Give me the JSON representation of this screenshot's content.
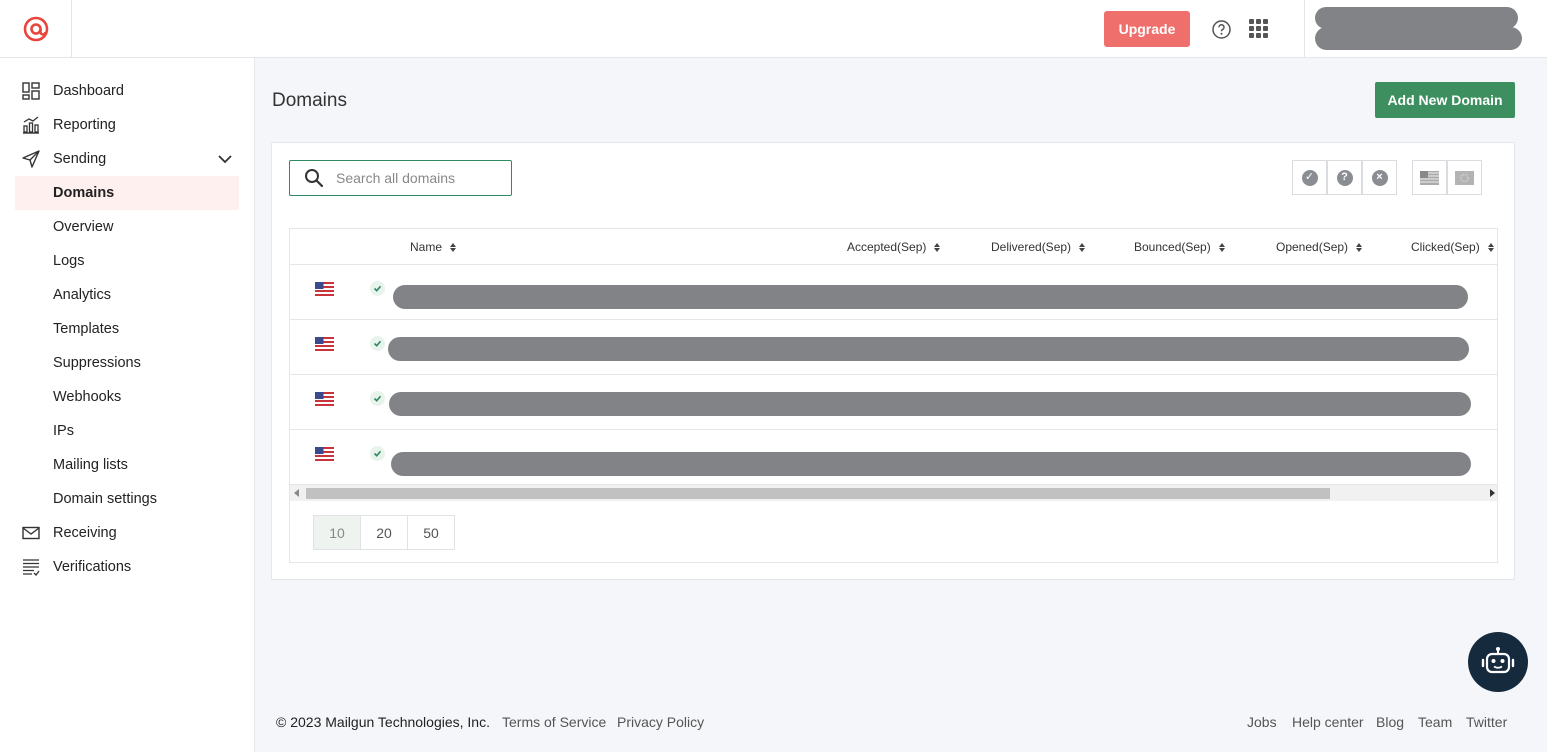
{
  "header": {
    "upgrade_label": "Upgrade"
  },
  "sidebar": {
    "items": [
      {
        "label": "Dashboard",
        "icon": "dashboard-icon"
      },
      {
        "label": "Reporting",
        "icon": "reporting-icon"
      },
      {
        "label": "Sending",
        "icon": "paper-plane-icon"
      },
      {
        "label": "Domains"
      },
      {
        "label": "Overview"
      },
      {
        "label": "Logs"
      },
      {
        "label": "Analytics"
      },
      {
        "label": "Templates"
      },
      {
        "label": "Suppressions"
      },
      {
        "label": "Webhooks"
      },
      {
        "label": "IPs"
      },
      {
        "label": "Mailing lists"
      },
      {
        "label": "Domain settings"
      },
      {
        "label": "Receiving",
        "icon": "envelope-icon"
      },
      {
        "label": "Verifications",
        "icon": "list-icon"
      }
    ]
  },
  "main": {
    "title": "Domains",
    "add_button_label": "Add New Domain",
    "search_placeholder": "Search all domains",
    "filters": {
      "verified": "✓",
      "unverified": "?",
      "disabled": "×"
    },
    "columns": [
      "Name",
      "Accepted(Sep)",
      "Delivered(Sep)",
      "Bounced(Sep)",
      "Opened(Sep)",
      "Clicked(Sep)"
    ],
    "rows": [
      {
        "flag": "us-flag-icon",
        "status": "verified"
      },
      {
        "flag": "us-flag-icon",
        "status": "verified"
      },
      {
        "flag": "us-flag-icon",
        "status": "verified"
      },
      {
        "flag": "us-flag-icon",
        "status": "verified"
      }
    ],
    "page_sizes": [
      "10",
      "20",
      "50"
    ],
    "selected_page_size": "10"
  },
  "footer": {
    "copyright": "© 2023 Mailgun Technologies, Inc.",
    "left_links": [
      "Terms of Service",
      "Privacy Policy"
    ],
    "right_links": [
      "Jobs",
      "Help center",
      "Blog",
      "Team",
      "Twitter"
    ]
  },
  "colors": {
    "upgrade": "#ef6f6c",
    "primary": "#3e8f5f",
    "logo": "#e8453c",
    "bot": "#162a3d"
  }
}
